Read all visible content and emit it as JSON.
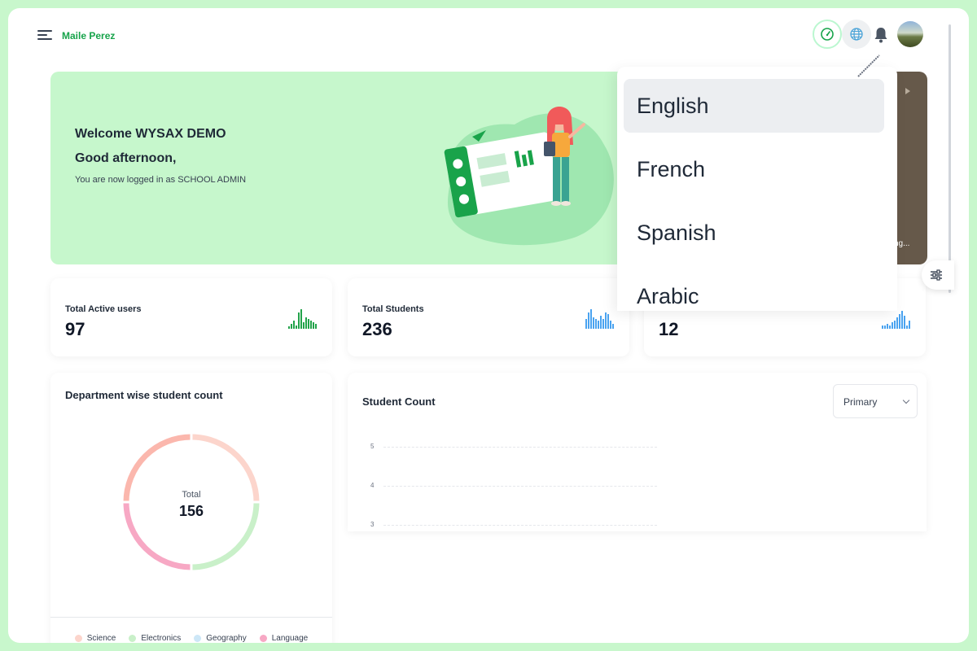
{
  "header": {
    "user_name": "Maile Perez"
  },
  "welcome": {
    "title": "Welcome WYSAX DEMO",
    "greeting": "Good afternoon,",
    "subtitle": "You are now logged in as SCHOOL ADMIN"
  },
  "dark_card": {
    "partial_text": "ng..."
  },
  "stats": [
    {
      "label": "Total Active users",
      "value": "97",
      "color": "#22a34a"
    },
    {
      "label": "Total Students",
      "value": "236",
      "color": "#4aa3f0"
    },
    {
      "label": "",
      "value": "12",
      "color": "#4aa3f0"
    }
  ],
  "department": {
    "title": "Department wise student count",
    "total_label": "Total",
    "total_value": "156",
    "legend": [
      {
        "label": "Science",
        "color": "#fcd5cc"
      },
      {
        "label": "Electronics",
        "color": "#c9f0c9"
      },
      {
        "label": "Geography",
        "color": "#cde7f7"
      },
      {
        "label": "Language",
        "color": "#f7a8c4"
      }
    ]
  },
  "student_count": {
    "title": "Student Count",
    "select_value": "Primary",
    "y_ticks": [
      "5",
      "4",
      "3"
    ]
  },
  "language_menu": {
    "items": [
      "English",
      "French",
      "Spanish",
      "Arabic"
    ],
    "selected": "English"
  },
  "colors": {
    "accent": "#16a34a",
    "welcome_bg": "#c6f7cc"
  }
}
